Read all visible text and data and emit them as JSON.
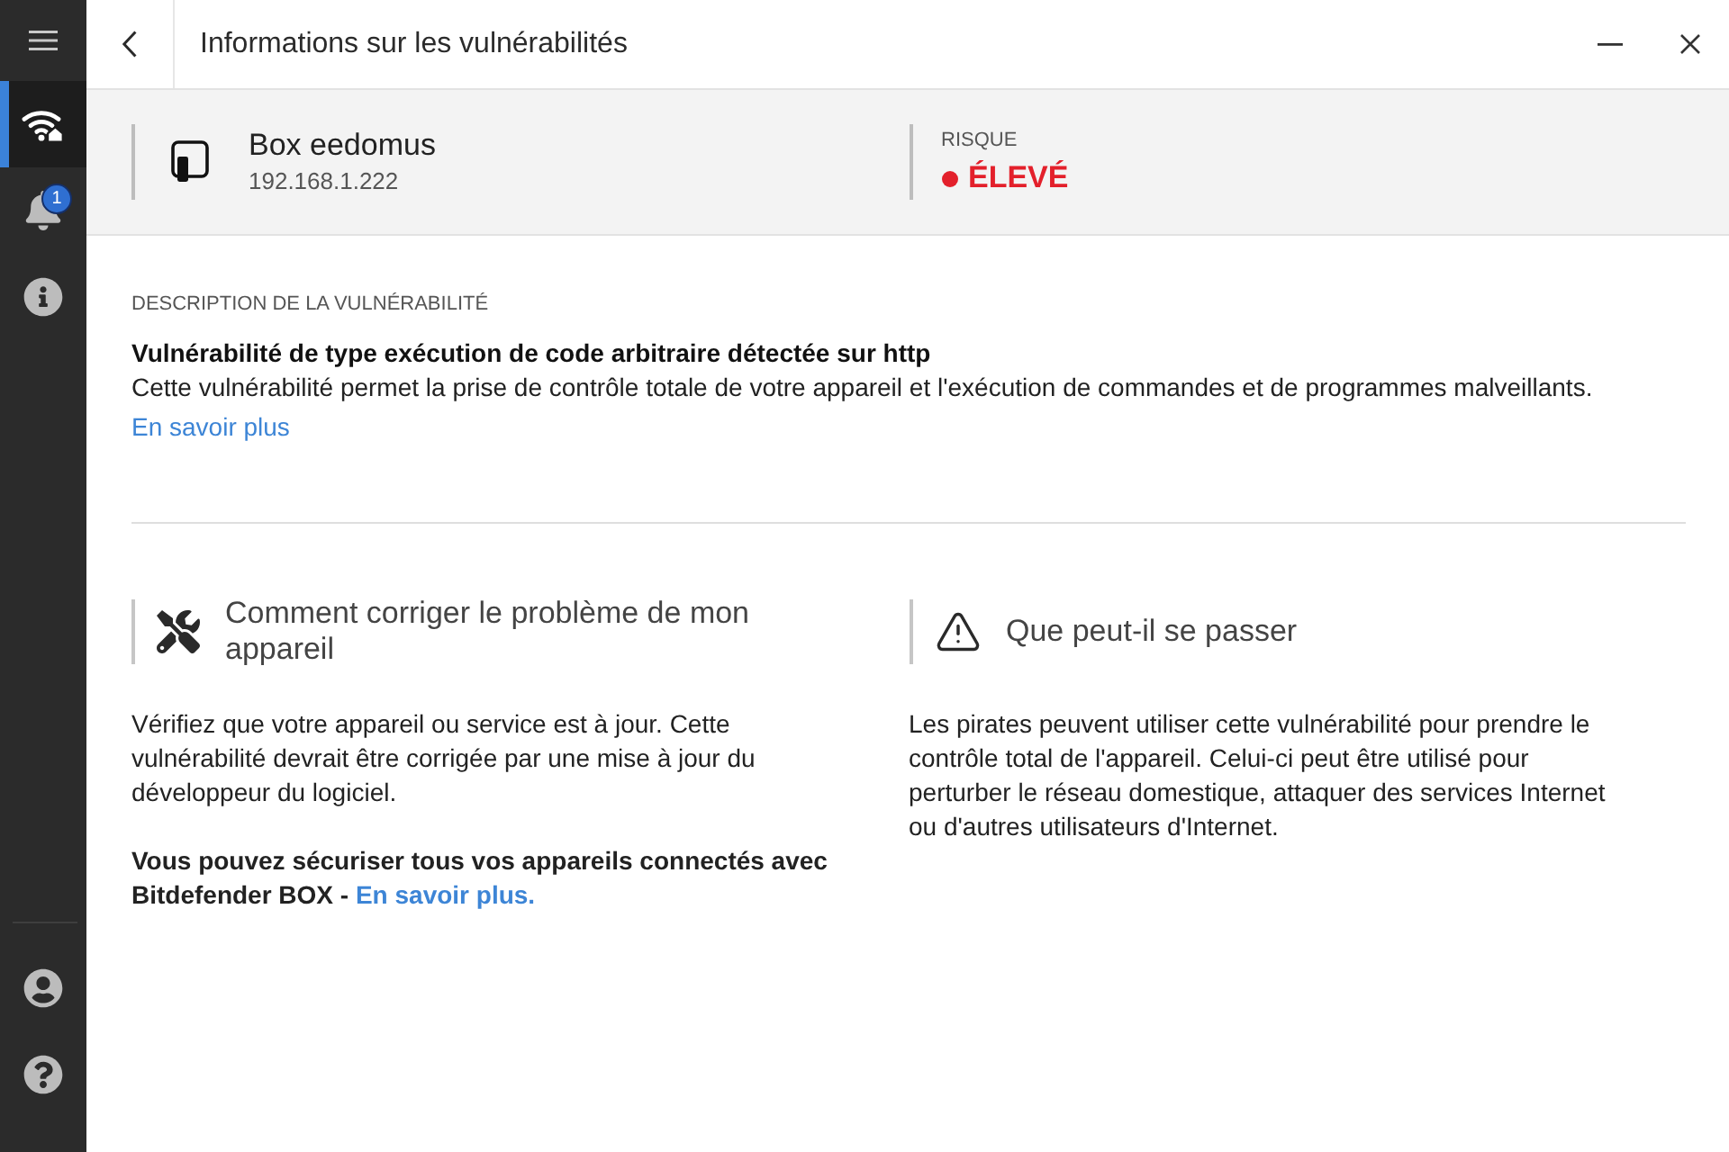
{
  "window": {
    "title": "Informations sur les vulnérabilités"
  },
  "sidebar": {
    "items": [
      {
        "selected": true
      },
      {
        "selected": false,
        "badge": "1"
      },
      {
        "selected": false
      }
    ]
  },
  "device": {
    "name": "Box eedomus",
    "address": "192.168.1.222"
  },
  "risk": {
    "label": "RISQUE",
    "value": "ÉLEVÉ"
  },
  "description": {
    "heading": "DESCRIPTION DE LA VULNÉRABILITÉ",
    "title": "Vulnérabilité de type exécution de code arbitraire détectée sur http",
    "text": "Cette vulnérabilité permet la prise de contrôle totale de votre appareil et l'exécution de commandes et de programmes malveillants.",
    "link": "En savoir plus"
  },
  "sections": [
    {
      "title": "Comment corriger le problème de mon appareil",
      "paragraphs": [
        {
          "kind": "plain",
          "text": "Vérifiez que votre appareil ou service est à jour. Cette vulnérabilité devrait être corrigée par une mise à jour du développeur du logiciel."
        },
        {
          "kind": "bold",
          "text": "Vous pouvez sécuriser tous vos appareils connectés avec Bitdefender BOX -",
          "link": "En savoir plus."
        }
      ]
    },
    {
      "title": "Que peut-il se passer",
      "paragraphs": [
        {
          "kind": "plain",
          "text": "Les pirates peuvent utiliser cette vulnérabilité pour prendre le contrôle total de l'appareil. Celui-ci peut être utilisé pour perturber le réseau domestique, attaquer des services Internet ou d'autres utilisateurs d'Internet."
        }
      ]
    }
  ]
}
